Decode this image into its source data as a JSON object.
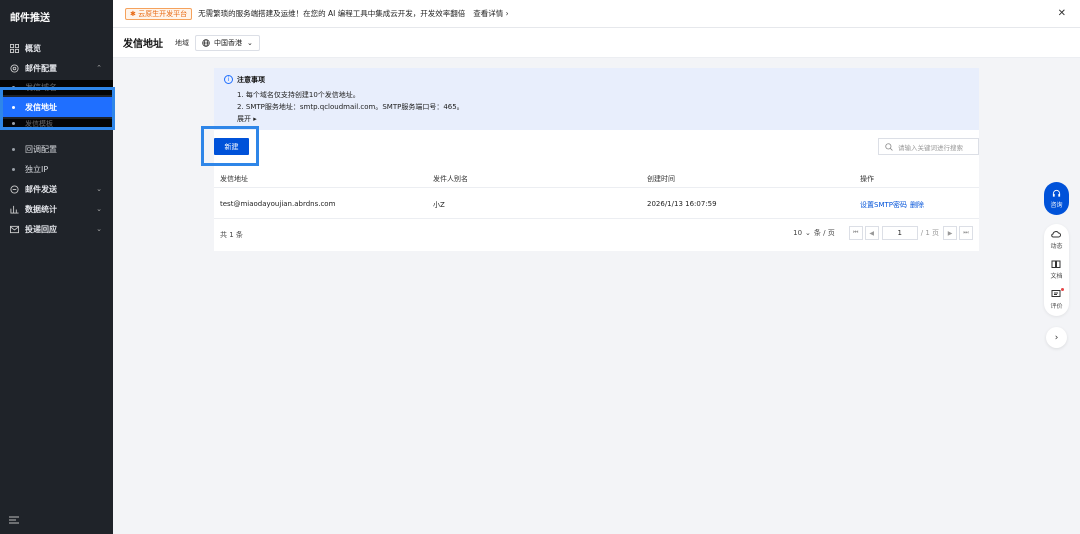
{
  "sidebar": {
    "title": "邮件推送",
    "items": [
      {
        "label": "概览",
        "icon": "grid-icon"
      },
      {
        "label": "邮件配置",
        "icon": "settings-icon"
      },
      {
        "label": "邮件发送",
        "icon": "send-icon"
      },
      {
        "label": "数据统计",
        "icon": "chart-icon"
      },
      {
        "label": "投递回应",
        "icon": "mail-icon"
      }
    ],
    "sub_items": [
      {
        "label": "发信域名"
      },
      {
        "label": "发信地址"
      },
      {
        "label": "发信模板"
      },
      {
        "label": "回调配置"
      },
      {
        "label": "独立IP"
      }
    ]
  },
  "banner": {
    "badge": "✱ 云原生开发平台",
    "text": "无需繁琐的服务端搭建及运维！在您的 AI 编程工具中集成云开发，开发效率翻倍",
    "link": "查看详情 ›"
  },
  "header": {
    "title": "发信地址",
    "region_label": "地域",
    "region_value": "中国香港"
  },
  "notice": {
    "title": "注意事项",
    "line1": "1. 每个域名仅支持创建10个发信地址。",
    "line2": "2. SMTP服务地址：smtp.qcloudmail.com。SMTP服务端口号：465。",
    "expand": "展开 ▸"
  },
  "toolbar": {
    "new_label": "新建",
    "search_placeholder": "请输入关键词进行搜索"
  },
  "table": {
    "columns": [
      "发信地址",
      "发件人别名",
      "创建时间",
      "操作"
    ],
    "rows": [
      {
        "address": "test@miaodayoujian.abrdns.com",
        "alias": "小Z",
        "created": "2026/1/13 16:07:59",
        "action_smtp": "设置SMTP密码",
        "action_delete": "删除"
      }
    ]
  },
  "pagination": {
    "total": "共 1 条",
    "page_size": "10",
    "page_size_unit": "条 / 页",
    "current": "1",
    "total_pages": "/ 1 页"
  },
  "float": {
    "consult": "咨询",
    "news": "动态",
    "docs": "文档",
    "review": "评价"
  },
  "colors": {
    "sidebar_bg": "#1f2329",
    "primary": "#0052d9",
    "active": "#1f6fff",
    "highlight": "#2f86e8"
  }
}
